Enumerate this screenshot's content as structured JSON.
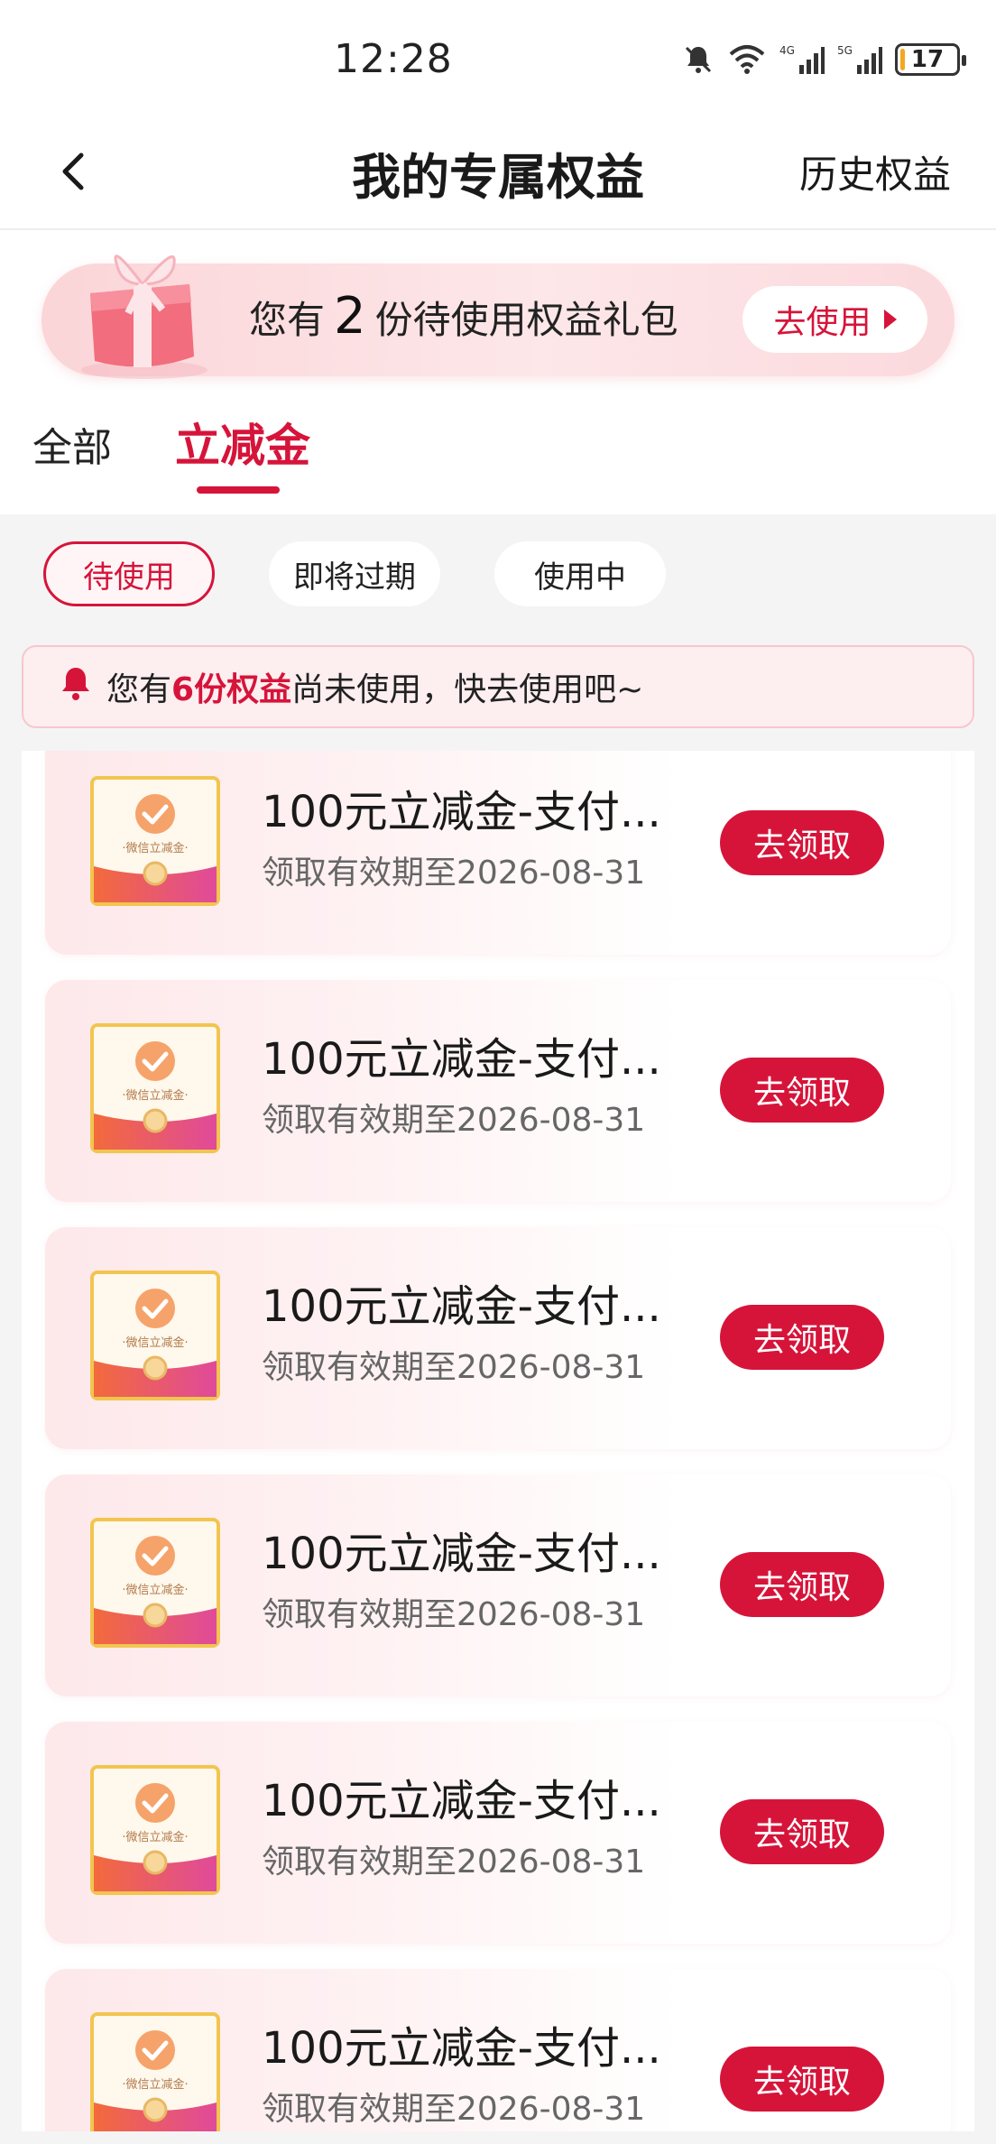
{
  "status_bar": {
    "time": "12:28",
    "network_1": "4G",
    "network_2": "5G",
    "battery_level": "17",
    "battery_percent": 17
  },
  "header": {
    "title": "我的专属权益",
    "history_link": "历史权益",
    "back_icon": "chevron-left-icon"
  },
  "banner": {
    "prefix": "您有",
    "count": "2",
    "suffix": "份待使用权益礼包",
    "button_label": "去使用"
  },
  "main_tabs": [
    {
      "label": "全部",
      "active": false
    },
    {
      "label": "立减金",
      "active": true
    }
  ],
  "filter_chips": [
    {
      "label": "待使用",
      "active": true
    },
    {
      "label": "即将过期",
      "active": false
    },
    {
      "label": "使用中",
      "active": false
    }
  ],
  "notice": {
    "prefix": "您有",
    "highlight": "6份权益",
    "suffix": "尚未使用，快去使用吧~"
  },
  "coupons": [
    {
      "title": "100元立减金-支付...",
      "expiry": "领取有效期至2026-08-31",
      "button": "去领取",
      "thumb_label": "·微信立减金·"
    },
    {
      "title": "100元立减金-支付...",
      "expiry": "领取有效期至2026-08-31",
      "button": "去领取",
      "thumb_label": "·微信立减金·"
    },
    {
      "title": "100元立减金-支付...",
      "expiry": "领取有效期至2026-08-31",
      "button": "去领取",
      "thumb_label": "·微信立减金·"
    },
    {
      "title": "100元立减金-支付...",
      "expiry": "领取有效期至2026-08-31",
      "button": "去领取",
      "thumb_label": "·微信立减金·"
    },
    {
      "title": "100元立减金-支付...",
      "expiry": "领取有效期至2026-08-31",
      "button": "去领取",
      "thumb_label": "·微信立减金·"
    },
    {
      "title": "100元立减金-支付...",
      "expiry": "领取有效期至2026-08-31",
      "button": "去领取",
      "thumb_label": "·微信立减金·"
    }
  ],
  "colors": {
    "accent": "#d6143a",
    "banner_bg": "#fbd5d8",
    "notice_bg": "#fdeef0",
    "content_bg": "#f4f4f4"
  }
}
